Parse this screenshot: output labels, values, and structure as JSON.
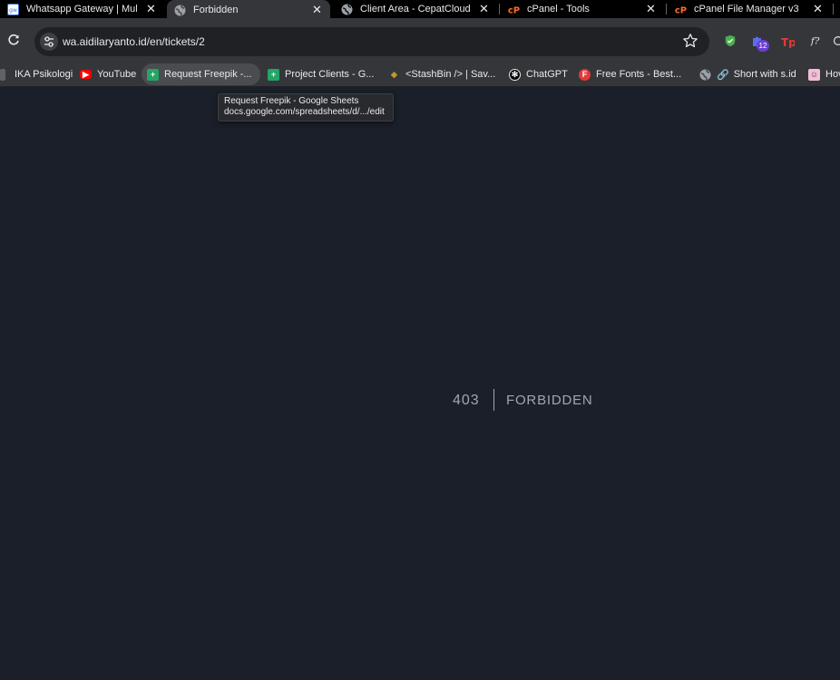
{
  "tabs": [
    {
      "title": "Whatsapp Gateway | Mul",
      "icon": "wa-gateway-icon"
    },
    {
      "title": "Forbidden",
      "icon": "globe-icon"
    },
    {
      "title": "Client Area - CepatCloud",
      "icon": "globe-icon"
    },
    {
      "title": "cPanel - Tools",
      "icon": "cpanel-icon"
    },
    {
      "title": "cPanel File Manager v3",
      "icon": "cpanel-icon"
    }
  ],
  "tab_close_glyph": "✕",
  "address_bar": {
    "url": "wa.aidilaryanto.id/en/tickets/2"
  },
  "extensions": {
    "badge_count": "12"
  },
  "bookmarks": [
    {
      "label": "IKA Psikologi",
      "icon": "folder-icon"
    },
    {
      "label": "YouTube",
      "icon": "youtube-icon"
    },
    {
      "label": "Request Freepik -...",
      "icon": "sheets-icon"
    },
    {
      "label": "Project Clients - G...",
      "icon": "sheets-icon"
    },
    {
      "label": "<StashBin /> | Sav...",
      "icon": "stashbin-icon"
    },
    {
      "label": "ChatGPT",
      "icon": "chatgpt-icon"
    },
    {
      "label": "Free Fonts - Best...",
      "icon": "freefonts-icon"
    },
    {
      "label": "Short with s.id",
      "icon": "link-icon"
    },
    {
      "label": "Hov",
      "icon": "hov-icon"
    }
  ],
  "tooltip": {
    "title": "Request Freepik - Google Sheets",
    "url": "docs.google.com/spreadsheets/d/.../edit"
  },
  "page": {
    "error_code": "403",
    "error_message": "FORBIDDEN"
  },
  "colors": {
    "page_background": "#1b1f29",
    "error_text": "#a0a6b1",
    "tab_strip": "#000000",
    "toolbar": "#35363a",
    "sheets_green": "#23a566",
    "cpanel_orange": "#ff6c2c",
    "youtube_red": "#ff0000"
  }
}
